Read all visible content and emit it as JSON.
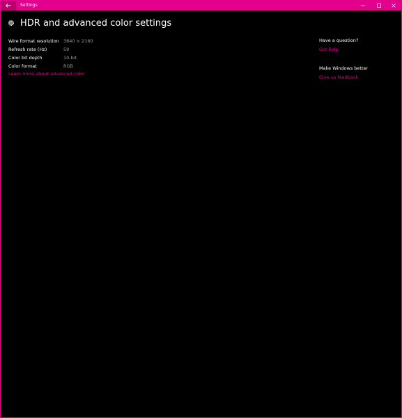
{
  "window": {
    "title": "Settings",
    "accent_color": "#e3008c"
  },
  "titlebar": {
    "back_icon": "back-arrow-icon",
    "minimize_icon": "minimize-icon",
    "maximize_icon": "maximize-icon",
    "close_icon": "close-icon"
  },
  "page": {
    "title": "HDR and advanced color settings",
    "title_icon": "gear-icon"
  },
  "display_info": [
    {
      "label": "Wire format resolution",
      "value": "3840 × 2160"
    },
    {
      "label": "Refresh rate (Hz)",
      "value": "59"
    },
    {
      "label": "Color bit depth",
      "value": "10-bit"
    },
    {
      "label": "Color format",
      "value": "RGB"
    }
  ],
  "learn_more_link": "Learn more about advanced color",
  "sidebar": {
    "question_heading": "Have a question?",
    "get_help_link": "Get help",
    "feedback_heading": "Make Windows better",
    "feedback_link": "Give us feedback"
  }
}
